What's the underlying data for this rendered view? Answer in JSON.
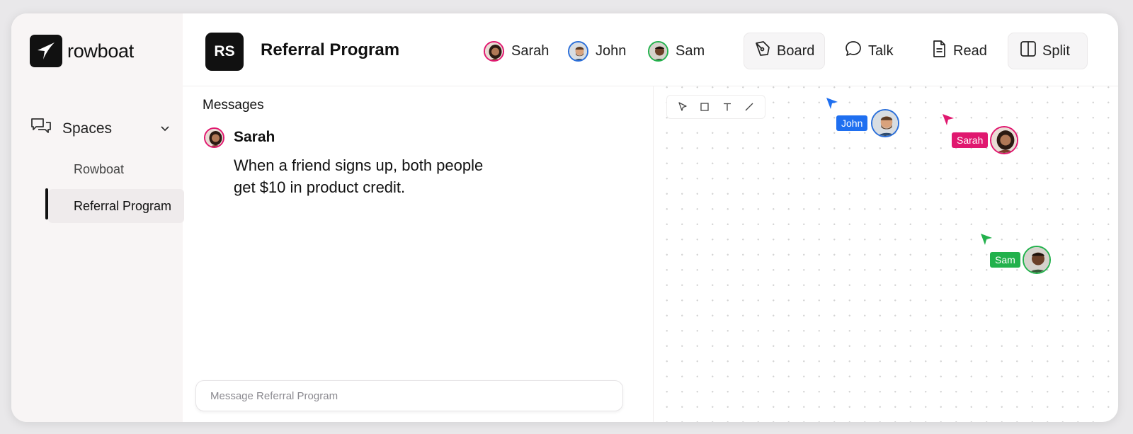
{
  "app": {
    "name": "rowboat"
  },
  "sidebar": {
    "section_label": "Spaces",
    "items": [
      {
        "label": "Rowboat"
      },
      {
        "label": "Referral Program"
      }
    ]
  },
  "header": {
    "badge": "RS",
    "title": "Referral Program",
    "members": [
      {
        "name": "Sarah",
        "color": "#e0186f"
      },
      {
        "name": "John",
        "color": "#2b6fd9"
      },
      {
        "name": "Sam",
        "color": "#22b14c"
      }
    ],
    "views": [
      {
        "label": "Board",
        "icon": "pen-nib-icon"
      },
      {
        "label": "Talk",
        "icon": "chat-bubble-icon"
      },
      {
        "label": "Read",
        "icon": "document-icon"
      },
      {
        "label": "Split",
        "icon": "split-view-icon"
      }
    ]
  },
  "messages": {
    "heading": "Messages",
    "items": [
      {
        "author": "Sarah",
        "text": "When a friend signs up, both people get $10 in product credit."
      }
    ],
    "composer_placeholder": "Message Referral Program"
  },
  "board": {
    "tools": [
      "pointer-icon",
      "rectangle-icon",
      "text-icon",
      "line-icon"
    ],
    "cursors": [
      {
        "name": "John",
        "color": "#1f6ff0"
      },
      {
        "name": "Sarah",
        "color": "#e0186f"
      },
      {
        "name": "Sam",
        "color": "#22b14c"
      }
    ]
  }
}
